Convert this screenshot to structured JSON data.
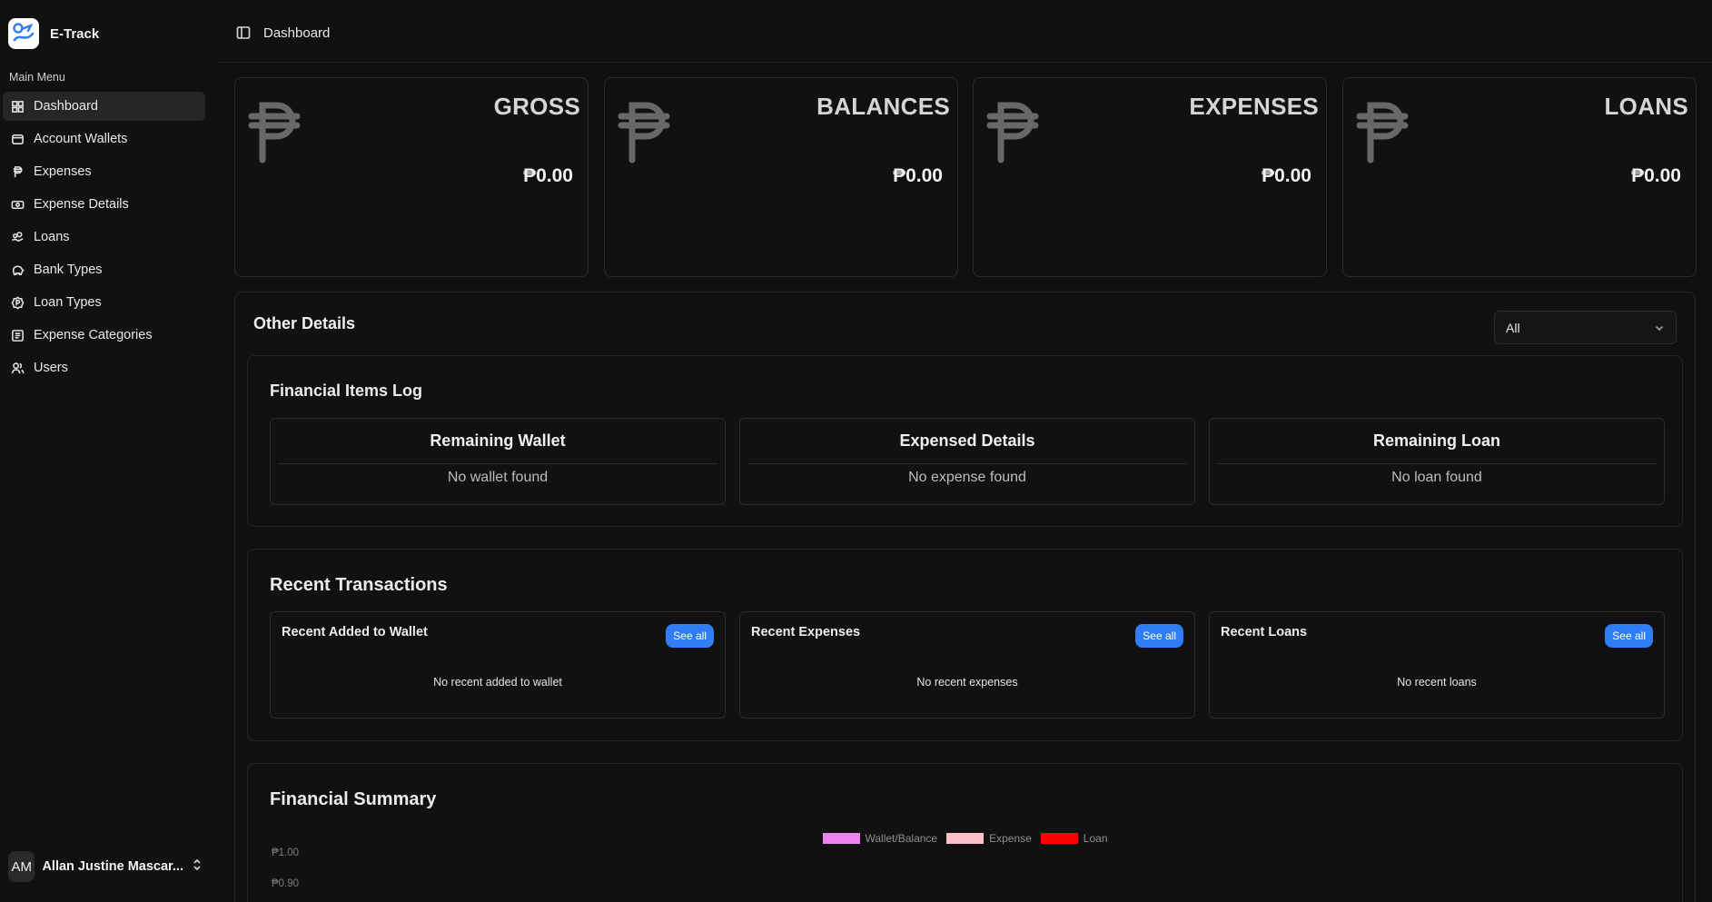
{
  "app": {
    "name": "E-Track"
  },
  "sidebar": {
    "heading": "Main Menu",
    "items": [
      {
        "label": "Dashboard",
        "icon": "grid-icon",
        "active": true
      },
      {
        "label": "Account Wallets",
        "icon": "wallet-icon"
      },
      {
        "label": "Expenses",
        "icon": "peso-icon"
      },
      {
        "label": "Expense Details",
        "icon": "banknote-icon"
      },
      {
        "label": "Loans",
        "icon": "hand-coins-icon"
      },
      {
        "label": "Bank Types",
        "icon": "piggy-bank-icon"
      },
      {
        "label": "Loan Types",
        "icon": "badge-peso-icon"
      },
      {
        "label": "Expense Categories",
        "icon": "list-icon"
      },
      {
        "label": "Users",
        "icon": "users-icon"
      }
    ],
    "user": {
      "initials": "AM",
      "name": "Allan Justine Mascar..."
    }
  },
  "header": {
    "breadcrumb": "Dashboard"
  },
  "stats": [
    {
      "title": "GROSS",
      "value": "₱0.00"
    },
    {
      "title": "BALANCES",
      "value": "₱0.00"
    },
    {
      "title": "EXPENSES",
      "value": "₱0.00"
    },
    {
      "title": "LOANS",
      "value": "₱0.00"
    }
  ],
  "other_details": {
    "title": "Other Details",
    "filter": {
      "value": "All"
    },
    "financial_log": {
      "title": "Financial Items Log",
      "cards": [
        {
          "title": "Remaining Wallet",
          "empty": "No wallet found"
        },
        {
          "title": "Expensed Details",
          "empty": "No expense found"
        },
        {
          "title": "Remaining Loan",
          "empty": "No loan found"
        }
      ]
    },
    "recent_transactions": {
      "title": "Recent Transactions",
      "see_all_label": "See all",
      "cards": [
        {
          "title": "Recent Added to Wallet",
          "empty": "No recent added to wallet"
        },
        {
          "title": "Recent Expenses",
          "empty": "No recent expenses"
        },
        {
          "title": "Recent Loans",
          "empty": "No recent loans"
        }
      ]
    },
    "financial_summary": {
      "title": "Financial Summary"
    }
  },
  "chart_data": {
    "type": "bar",
    "title": "",
    "series": [
      {
        "name": "Wallet/Balance",
        "color": "#ee82ee",
        "values": []
      },
      {
        "name": "Expense",
        "color": "#ffc0cb",
        "values": []
      },
      {
        "name": "Loan",
        "color": "#ff0000",
        "values": []
      }
    ],
    "y_tick_labels": [
      "₱1.00",
      "₱0.90"
    ],
    "ylim": [
      0,
      1
    ],
    "legend": "top-center"
  }
}
